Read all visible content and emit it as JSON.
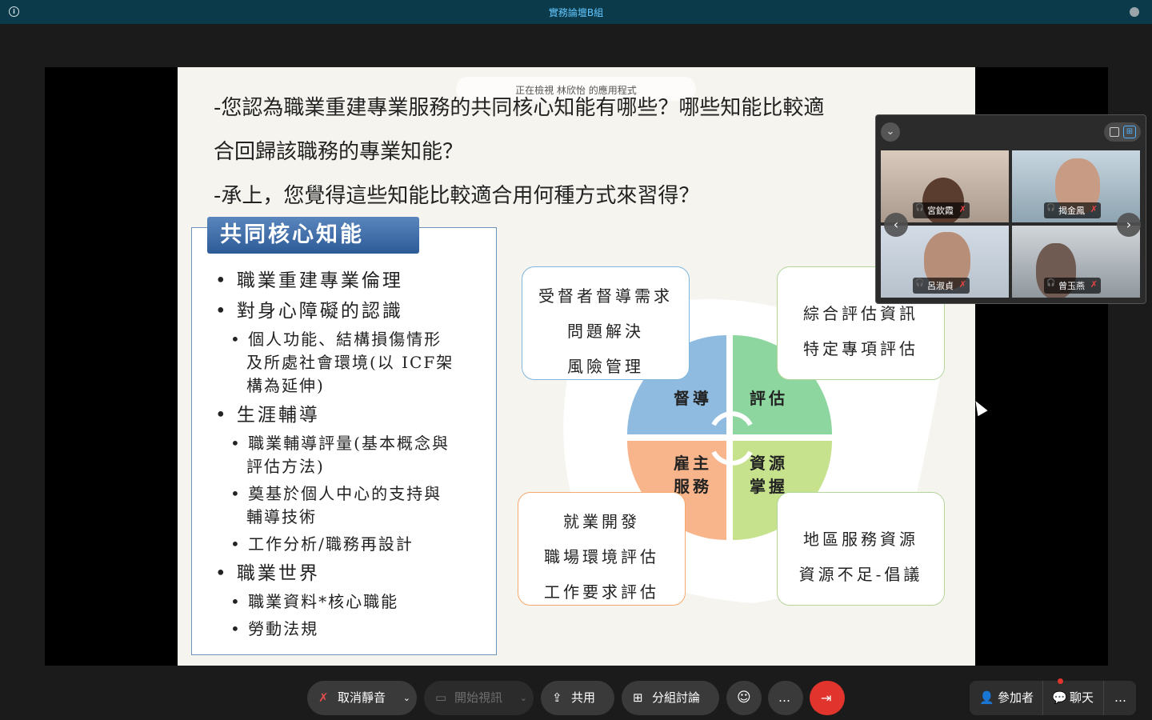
{
  "window": {
    "title": "實務論壇B組"
  },
  "share_banner": "正在檢視 林欣怡 的應用程式",
  "slide": {
    "question1_line1": "-您認為職業重建專業服務的共同核心知能有哪些？哪些知能比較適",
    "question1_line2": "合回歸該職務的專業知能？",
    "question2": "-承上，您覺得這些知能比較適合用何種方式來習得？",
    "panel_title": "共同核心知能",
    "list": [
      {
        "level": 1,
        "text": "職業重建專業倫理"
      },
      {
        "level": 1,
        "text": "對身心障礙的認識"
      },
      {
        "level": 2,
        "text": "個人功能、結構損傷情形"
      },
      {
        "level": 3,
        "text": "及所處社會環境(以 ICF架"
      },
      {
        "level": 3,
        "text": "構為延伸)"
      },
      {
        "level": 1,
        "text": "生涯輔導"
      },
      {
        "level": 2,
        "text": "職業輔導評量(基本概念與"
      },
      {
        "level": 3,
        "text": "評估方法)"
      },
      {
        "level": 2,
        "text": "奠基於個人中心的支持與"
      },
      {
        "level": 3,
        "text": "輔導技術"
      },
      {
        "level": 2,
        "text": "工作分析/職務再設計"
      },
      {
        "level": 1,
        "text": "職業世界"
      },
      {
        "level": 2,
        "text": "職業資料*核心職能"
      },
      {
        "level": 2,
        "text": "勞動法規"
      }
    ],
    "quadrants": {
      "tl": "督導",
      "tr": "評估",
      "bl1": "雇主",
      "bl2": "服務",
      "br1": "資源",
      "br2": "掌握"
    },
    "box_tl": [
      "受督者督導需求",
      "問題解決",
      "風險管理"
    ],
    "box_tr": [
      "綜合評估資訊",
      "特定專項評估"
    ],
    "box_bl": [
      "就業開發",
      "職場環境評估",
      "工作要求評估"
    ],
    "box_br": [
      "地區服務資源",
      "資源不足-倡議"
    ]
  },
  "participants": [
    "宮欽霞",
    "揭金鳳",
    "呂淑貞",
    "曾玉燕"
  ],
  "toolbar": {
    "mute": "取消靜音",
    "video": "開始視訊",
    "share": "共用",
    "breakout": "分組討論",
    "participants": "參加者",
    "chat": "聊天",
    "more": "…"
  },
  "colors": {
    "accent": "#0b3a4a",
    "title_text": "#63c7ff",
    "leave": "#e0342c",
    "supervise": "#7fb3dd",
    "assess": "#86d49a",
    "employer": "#f7b183",
    "resource": "#c5e28a"
  }
}
